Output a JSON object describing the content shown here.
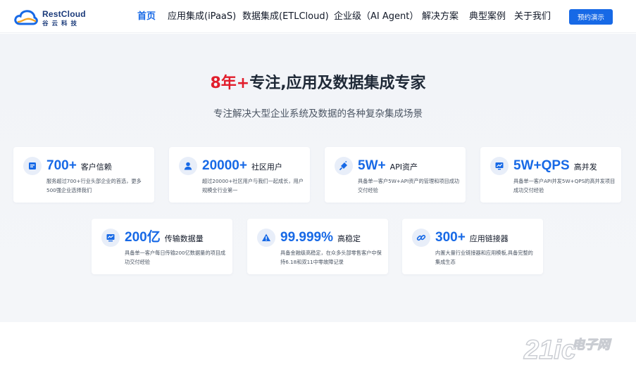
{
  "brand": {
    "name": "RestCloud",
    "subtitle": "谷云科技"
  },
  "nav": {
    "items": [
      {
        "label": "首页",
        "active": true
      },
      {
        "label": "应用集成(iPaaS)"
      },
      {
        "label": "数据集成(ETLCloud)"
      },
      {
        "label": "企业级（AI Agent）"
      },
      {
        "label": "解决方案"
      },
      {
        "label": "典型案例"
      },
      {
        "label": "关于我们"
      }
    ],
    "demo_button": "预约演示"
  },
  "hero": {
    "title_accent": "8年+",
    "title_rest": "专注,应用及数据集成专家",
    "subtitle": "专注解决大型企业系统及数据的各种复杂集成场景"
  },
  "stats": [
    {
      "icon": "document-icon",
      "number": "700+",
      "label": "客户信赖",
      "desc": "服务超过700+行业头部企业的首选，更多500强企业选择我们"
    },
    {
      "icon": "user-icon",
      "number": "20000+",
      "label": "社区用户",
      "desc": "超过20000+社区用户与我们一起成长，用户规模全行业第一"
    },
    {
      "icon": "plug-icon",
      "number": "5W+",
      "label": "API资产",
      "desc": "具备单一客户5W+API资产的管理和项目成功交付经验"
    },
    {
      "icon": "trend-monitor-icon",
      "number": "5W+QPS",
      "label": "高并发",
      "desc": "具备单一客户API并发5W+QPS的高并发项目成功交付经验"
    },
    {
      "icon": "chart-monitor-icon",
      "number": "200亿",
      "label": "传输数据量",
      "desc": "具备单一客户每日传输200亿数据量的项目成功交付经验"
    },
    {
      "icon": "warning-icon",
      "number": "99.999%",
      "label": "高稳定",
      "desc": "具备金融级高稳定，在众多头部零售客户中保持6.18和双11中零故障记录"
    },
    {
      "icon": "link-icon",
      "number": "300+",
      "label": "应用链接器",
      "desc": "内置大量行业链接器和应用模板,具备完整的集成生态"
    }
  ],
  "watermark": {
    "text": "21ic电子网"
  },
  "colors": {
    "accent": "#1769e6",
    "title_red": "#e11d2b",
    "background": "#f2f4f8"
  }
}
